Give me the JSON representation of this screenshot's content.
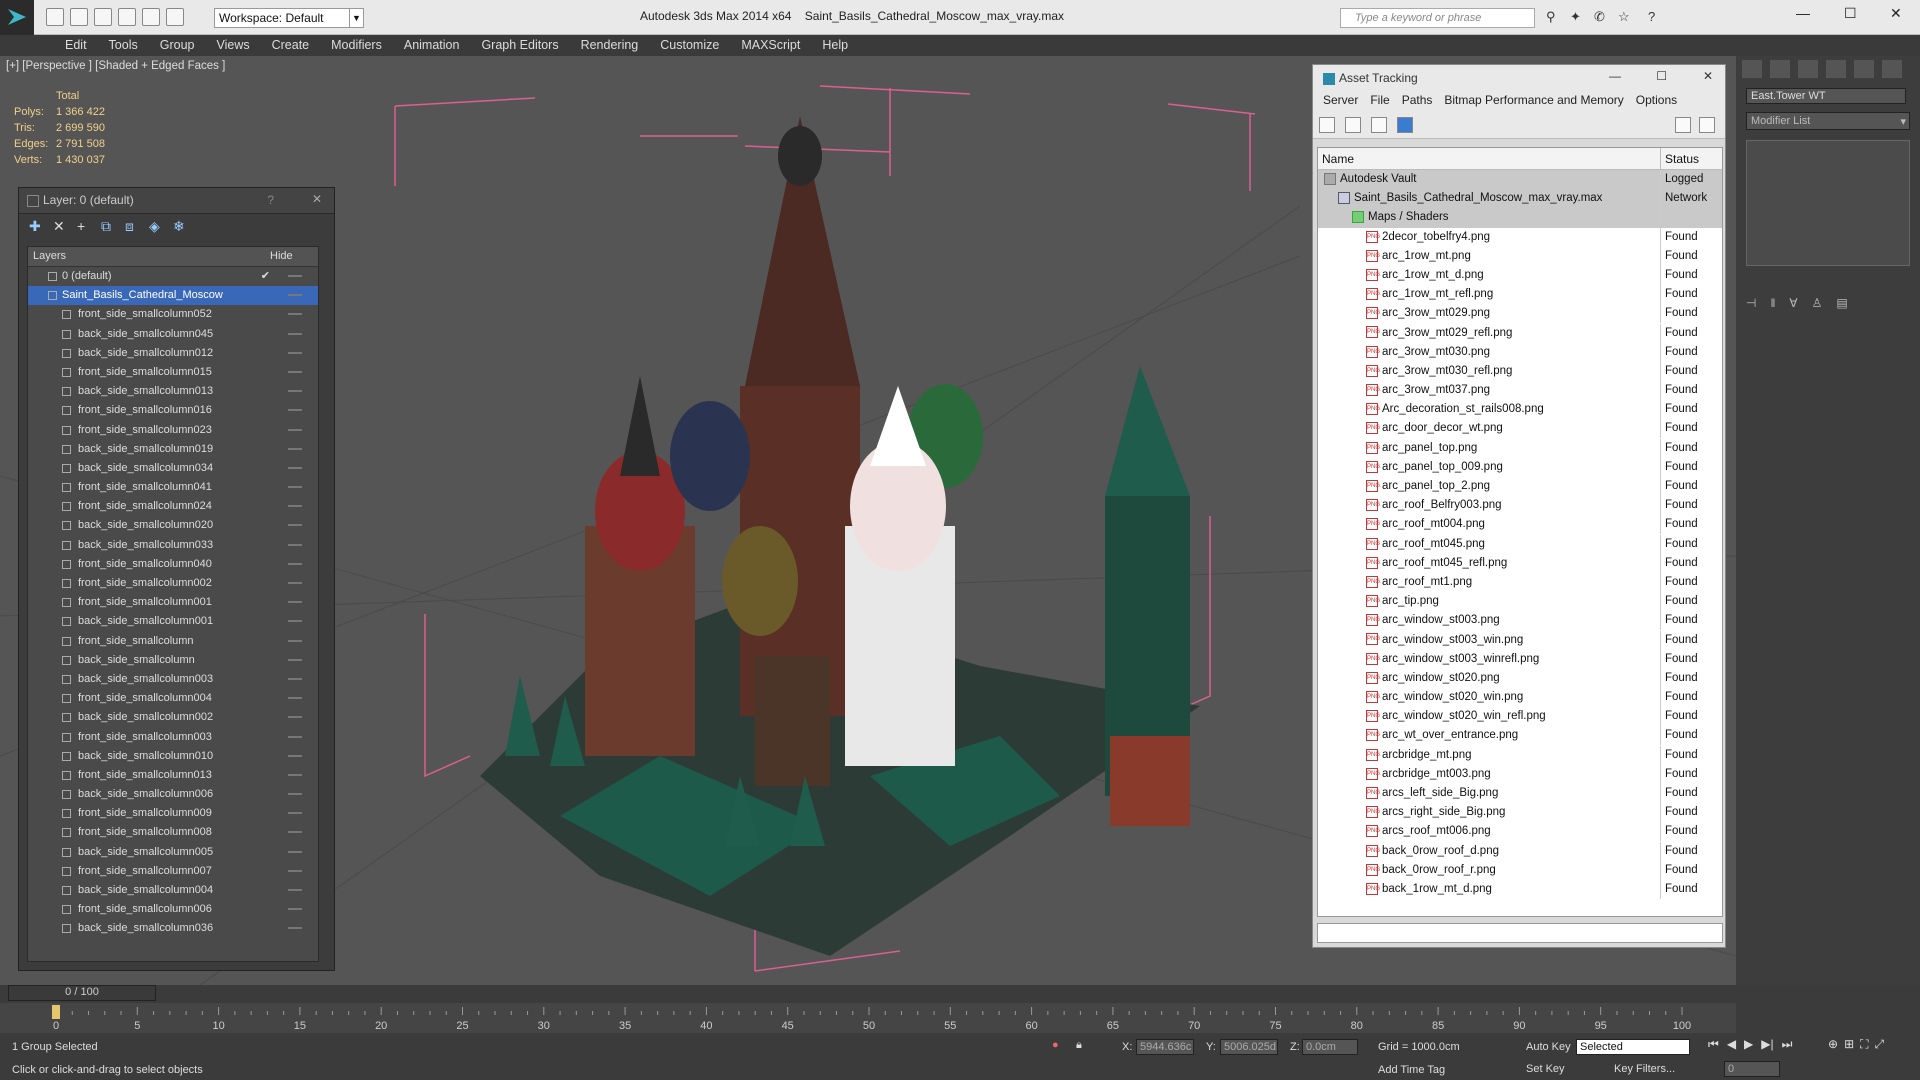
{
  "app": {
    "title": "Autodesk 3ds Max  2014 x64",
    "file": "Saint_Basils_Cathedral_Moscow_max_vray.max",
    "workspace": "Workspace: Default",
    "search_placeholder": "Type a keyword or phrase"
  },
  "menu": [
    "Edit",
    "Tools",
    "Group",
    "Views",
    "Create",
    "Modifiers",
    "Animation",
    "Graph Editors",
    "Rendering",
    "Customize",
    "MAXScript",
    "Help"
  ],
  "viewport": {
    "label": "[+] [Perspective ] [Shaded + Edged Faces ]",
    "stats": {
      "header": "Total",
      "rows": [
        {
          "k": "Polys:",
          "v": "1 366 422"
        },
        {
          "k": "Tris:",
          "v": "2 699 590"
        },
        {
          "k": "Edges:",
          "v": "2 791 508"
        },
        {
          "k": "Verts:",
          "v": "1 430 037"
        }
      ]
    }
  },
  "layer_panel": {
    "title": "Layer: 0 (default)",
    "col_layers": "Layers",
    "col_hide": "Hide",
    "rows": [
      "0 (default)",
      "Saint_Basils_Cathedral_Moscow",
      "front_side_smallcolumn052",
      "back_side_smallcolumn045",
      "back_side_smallcolumn012",
      "front_side_smallcolumn015",
      "back_side_smallcolumn013",
      "front_side_smallcolumn016",
      "front_side_smallcolumn023",
      "back_side_smallcolumn019",
      "back_side_smallcolumn034",
      "front_side_smallcolumn041",
      "front_side_smallcolumn024",
      "back_side_smallcolumn020",
      "back_side_smallcolumn033",
      "front_side_smallcolumn040",
      "front_side_smallcolumn002",
      "front_side_smallcolumn001",
      "back_side_smallcolumn001",
      "front_side_smallcolumn",
      "back_side_smallcolumn",
      "back_side_smallcolumn003",
      "front_side_smallcolumn004",
      "back_side_smallcolumn002",
      "front_side_smallcolumn003",
      "back_side_smallcolumn010",
      "front_side_smallcolumn013",
      "back_side_smallcolumn006",
      "front_side_smallcolumn009",
      "front_side_smallcolumn008",
      "back_side_smallcolumn005",
      "front_side_smallcolumn007",
      "back_side_smallcolumn004",
      "front_side_smallcolumn006",
      "back_side_smallcolumn036"
    ]
  },
  "asset_panel": {
    "title": "Asset Tracking",
    "menu": [
      "Server",
      "File",
      "Paths",
      "Bitmap Performance and Memory",
      "Options"
    ],
    "col_name": "Name",
    "col_status": "Status",
    "rows": [
      {
        "n": "Autodesk Vault",
        "s": "Logged",
        "lvl": 0
      },
      {
        "n": "Saint_Basils_Cathedral_Moscow_max_vray.max",
        "s": "Network",
        "lvl": 1
      },
      {
        "n": "Maps / Shaders",
        "s": "",
        "lvl": 2
      },
      {
        "n": "2decor_tobelfry4.png",
        "s": "Found",
        "lvl": 3
      },
      {
        "n": "arc_1row_mt.png",
        "s": "Found",
        "lvl": 3
      },
      {
        "n": "arc_1row_mt_d.png",
        "s": "Found",
        "lvl": 3
      },
      {
        "n": "arc_1row_mt_refl.png",
        "s": "Found",
        "lvl": 3
      },
      {
        "n": "arc_3row_mt029.png",
        "s": "Found",
        "lvl": 3
      },
      {
        "n": "arc_3row_mt029_refl.png",
        "s": "Found",
        "lvl": 3
      },
      {
        "n": "arc_3row_mt030.png",
        "s": "Found",
        "lvl": 3
      },
      {
        "n": "arc_3row_mt030_refl.png",
        "s": "Found",
        "lvl": 3
      },
      {
        "n": "arc_3row_mt037.png",
        "s": "Found",
        "lvl": 3
      },
      {
        "n": "Arc_decoration_st_rails008.png",
        "s": "Found",
        "lvl": 3
      },
      {
        "n": "arc_door_decor_wt.png",
        "s": "Found",
        "lvl": 3
      },
      {
        "n": "arc_panel_top.png",
        "s": "Found",
        "lvl": 3
      },
      {
        "n": "arc_panel_top_009.png",
        "s": "Found",
        "lvl": 3
      },
      {
        "n": "arc_panel_top_2.png",
        "s": "Found",
        "lvl": 3
      },
      {
        "n": "arc_roof_Belfry003.png",
        "s": "Found",
        "lvl": 3
      },
      {
        "n": "arc_roof_mt004.png",
        "s": "Found",
        "lvl": 3
      },
      {
        "n": "arc_roof_mt045.png",
        "s": "Found",
        "lvl": 3
      },
      {
        "n": "arc_roof_mt045_refl.png",
        "s": "Found",
        "lvl": 3
      },
      {
        "n": "arc_roof_mt1.png",
        "s": "Found",
        "lvl": 3
      },
      {
        "n": "arc_tip.png",
        "s": "Found",
        "lvl": 3
      },
      {
        "n": "arc_window_st003.png",
        "s": "Found",
        "lvl": 3
      },
      {
        "n": "arc_window_st003_win.png",
        "s": "Found",
        "lvl": 3
      },
      {
        "n": "arc_window_st003_winrefl.png",
        "s": "Found",
        "lvl": 3
      },
      {
        "n": "arc_window_st020.png",
        "s": "Found",
        "lvl": 3
      },
      {
        "n": "arc_window_st020_win.png",
        "s": "Found",
        "lvl": 3
      },
      {
        "n": "arc_window_st020_win_refl.png",
        "s": "Found",
        "lvl": 3
      },
      {
        "n": "arc_wt_over_entrance.png",
        "s": "Found",
        "lvl": 3
      },
      {
        "n": "arcbridge_mt.png",
        "s": "Found",
        "lvl": 3
      },
      {
        "n": "arcbridge_mt003.png",
        "s": "Found",
        "lvl": 3
      },
      {
        "n": "arcs_left_side_Big.png",
        "s": "Found",
        "lvl": 3
      },
      {
        "n": "arcs_right_side_Big.png",
        "s": "Found",
        "lvl": 3
      },
      {
        "n": "arcs_roof_mt006.png",
        "s": "Found",
        "lvl": 3
      },
      {
        "n": "back_0row_roof_d.png",
        "s": "Found",
        "lvl": 3
      },
      {
        "n": "back_0row_roof_r.png",
        "s": "Found",
        "lvl": 3
      },
      {
        "n": "back_1row_mt_d.png",
        "s": "Found",
        "lvl": 3
      }
    ]
  },
  "command_panel": {
    "object_name": "East.Tower WT",
    "modifier_list": "Modifier List"
  },
  "timeline": {
    "frame": "0 / 100",
    "ticks": [
      "0",
      "5",
      "10",
      "15",
      "20",
      "25",
      "30",
      "35",
      "40",
      "45",
      "50",
      "55",
      "60",
      "65",
      "70",
      "75",
      "80",
      "85",
      "90",
      "95",
      "100"
    ]
  },
  "status": {
    "selected": "1 Group Selected",
    "prompt": "Click or click-and-drag to select objects",
    "x": "5944.636c",
    "y": "5006.025d",
    "z": "0.0cm",
    "grid": "Grid = 1000.0cm",
    "auto_key": "Auto Key",
    "selected_dd": "Selected",
    "set_key": "Set Key",
    "key_filters": "Key Filters...",
    "add_time_tag": "Add Time Tag",
    "frame_val": "0"
  }
}
